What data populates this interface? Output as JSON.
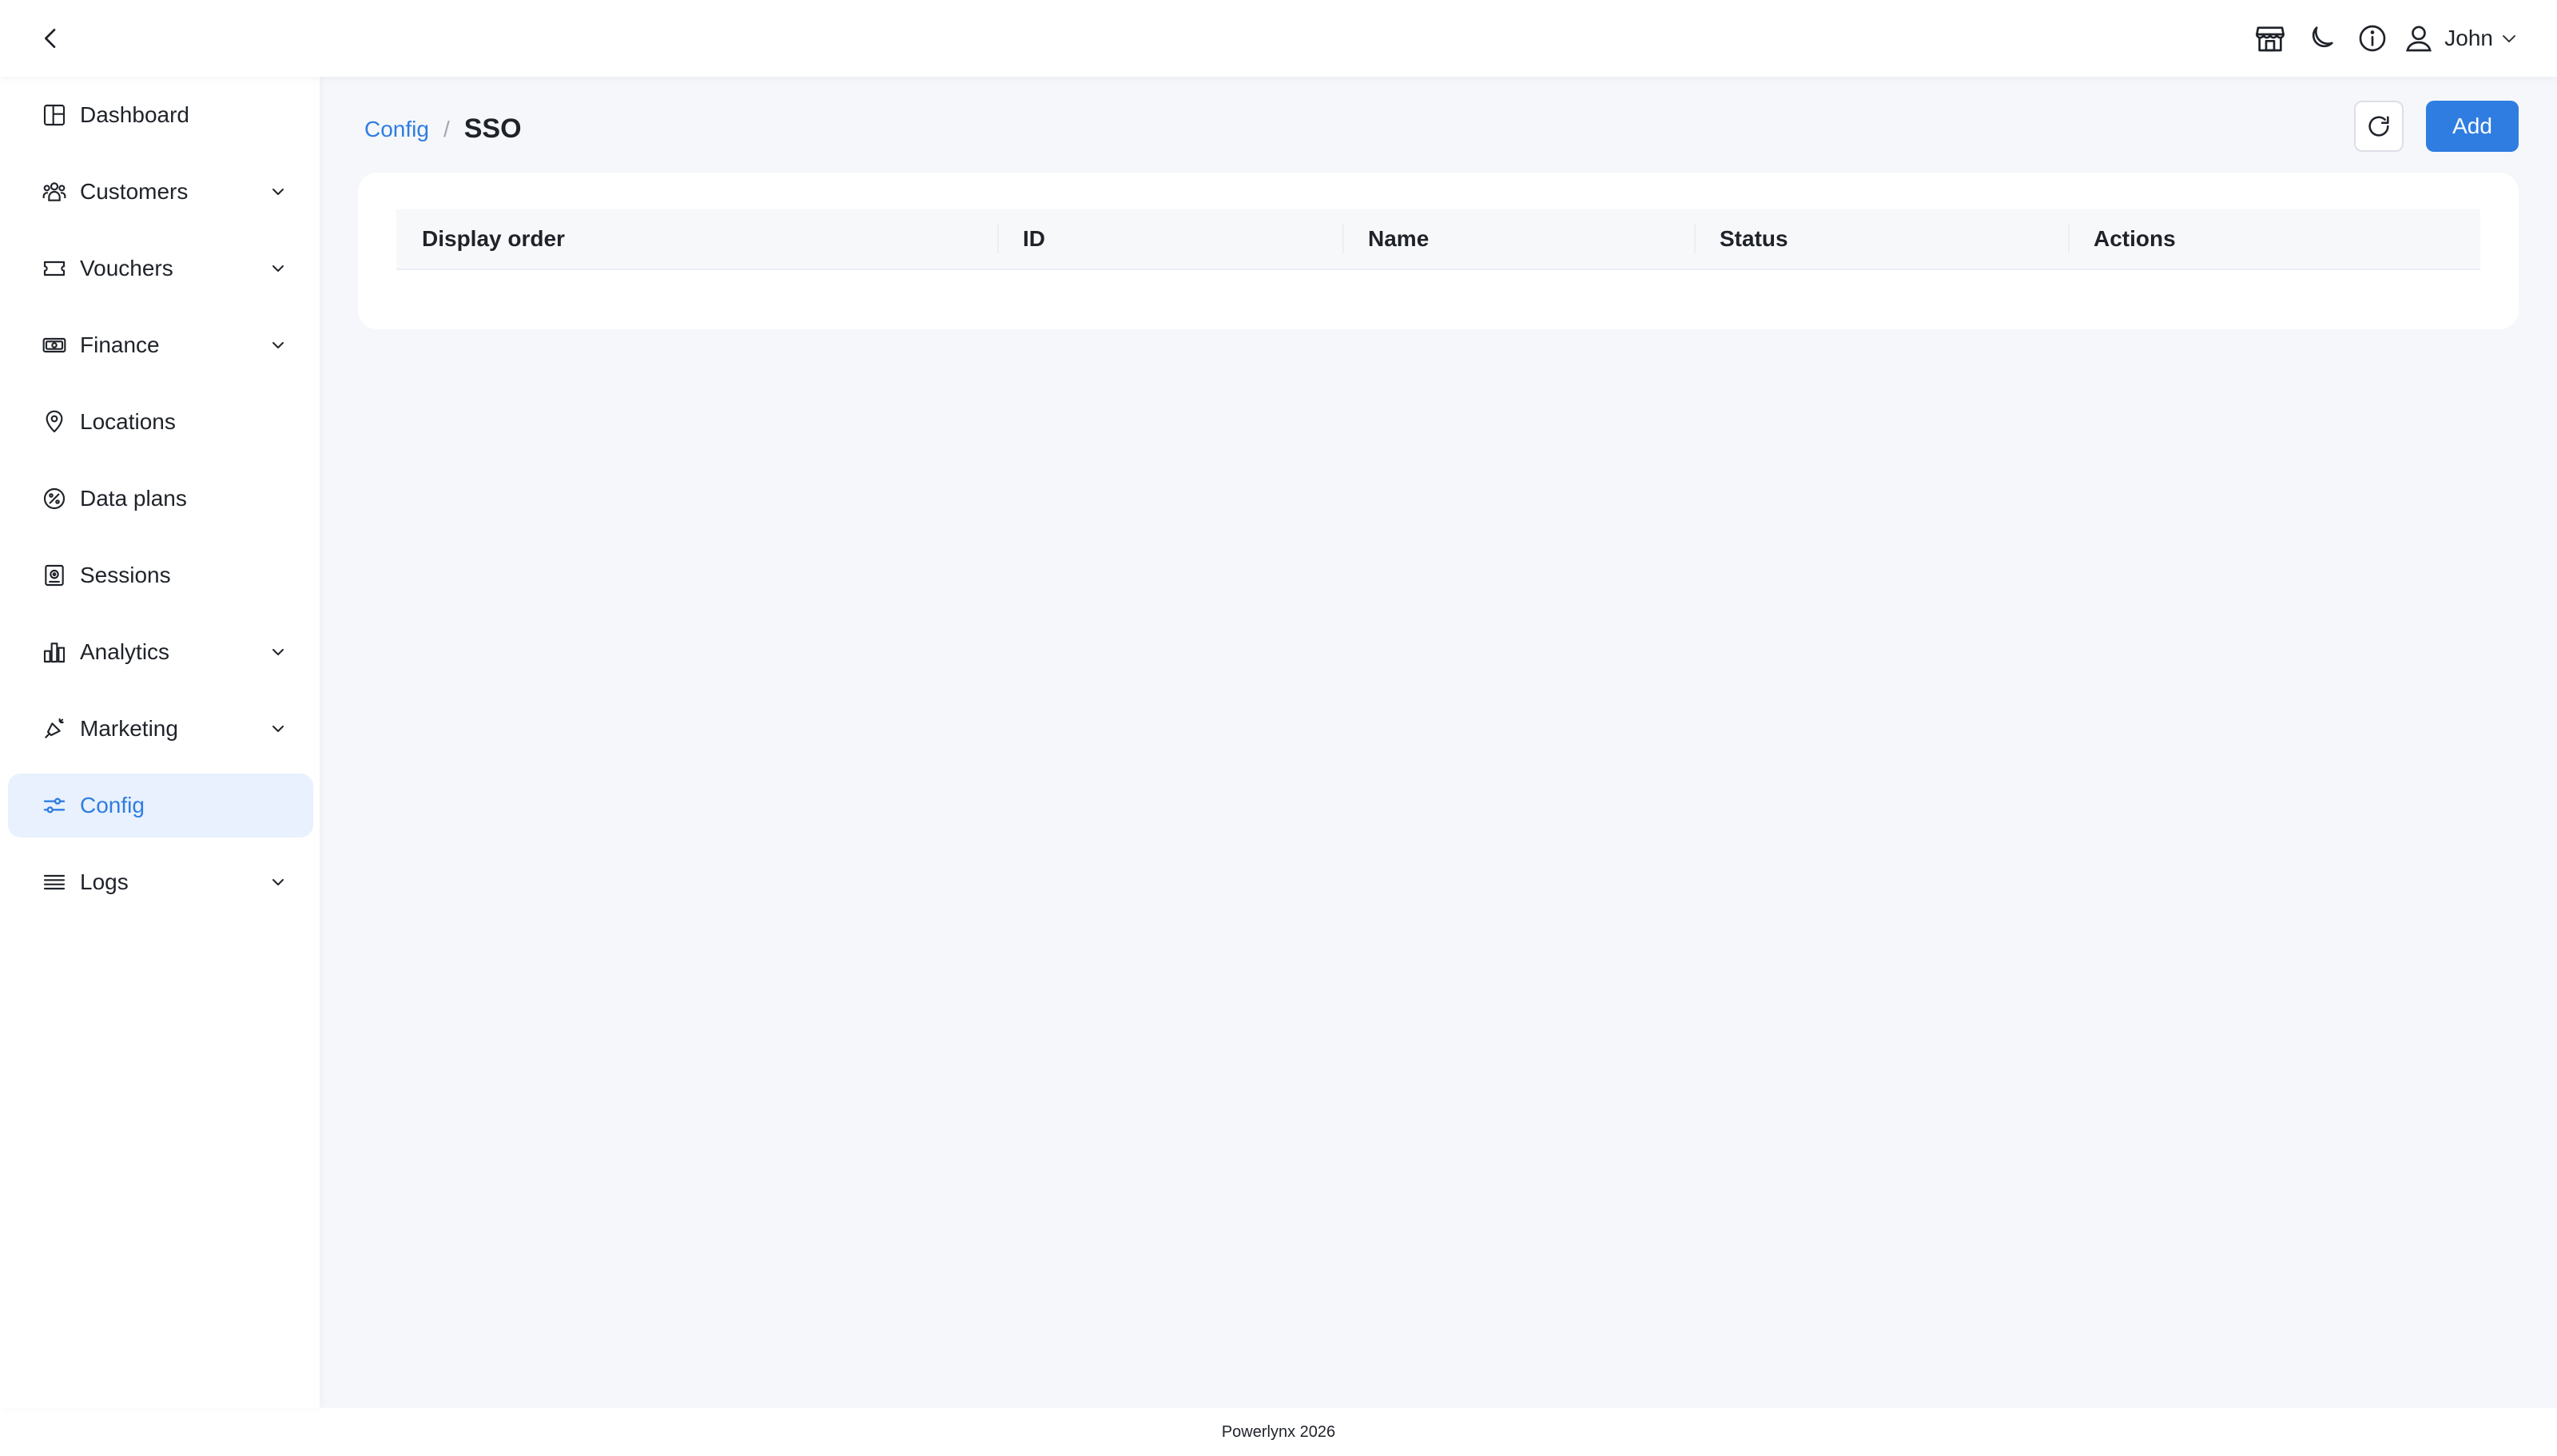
{
  "header": {
    "user_name": "John",
    "icons": [
      "back-icon",
      "store-icon",
      "moon-icon",
      "info-icon",
      "user-icon",
      "chevron-down-icon"
    ]
  },
  "sidebar": {
    "items": [
      {
        "label": "Dashboard",
        "icon": "dashboard-icon",
        "expandable": false,
        "active": false
      },
      {
        "label": "Customers",
        "icon": "customers-icon",
        "expandable": true,
        "active": false
      },
      {
        "label": "Vouchers",
        "icon": "ticket-icon",
        "expandable": true,
        "active": false
      },
      {
        "label": "Finance",
        "icon": "money-icon",
        "expandable": true,
        "active": false
      },
      {
        "label": "Locations",
        "icon": "location-pin-icon",
        "expandable": false,
        "active": false
      },
      {
        "label": "Data plans",
        "icon": "percent-icon",
        "expandable": false,
        "active": false
      },
      {
        "label": "Sessions",
        "icon": "sessions-icon",
        "expandable": false,
        "active": false
      },
      {
        "label": "Analytics",
        "icon": "bar-chart-icon",
        "expandable": true,
        "active": false
      },
      {
        "label": "Marketing",
        "icon": "megaphone-icon",
        "expandable": true,
        "active": false
      },
      {
        "label": "Config",
        "icon": "sliders-icon",
        "expandable": false,
        "active": true
      },
      {
        "label": "Logs",
        "icon": "list-icon",
        "expandable": true,
        "active": false
      }
    ]
  },
  "breadcrumb": {
    "parent": "Config",
    "separator": "/",
    "current": "SSO"
  },
  "toolbar": {
    "add_label": "Add"
  },
  "table": {
    "columns": [
      "Display order",
      "ID",
      "Name",
      "Status",
      "Actions"
    ],
    "rows": []
  },
  "footer": {
    "text": "Powerlynx 2026"
  },
  "colors": {
    "accent": "#2f7de1",
    "active_bg": "#e8f1fd",
    "page_bg": "#f5f7fa"
  }
}
